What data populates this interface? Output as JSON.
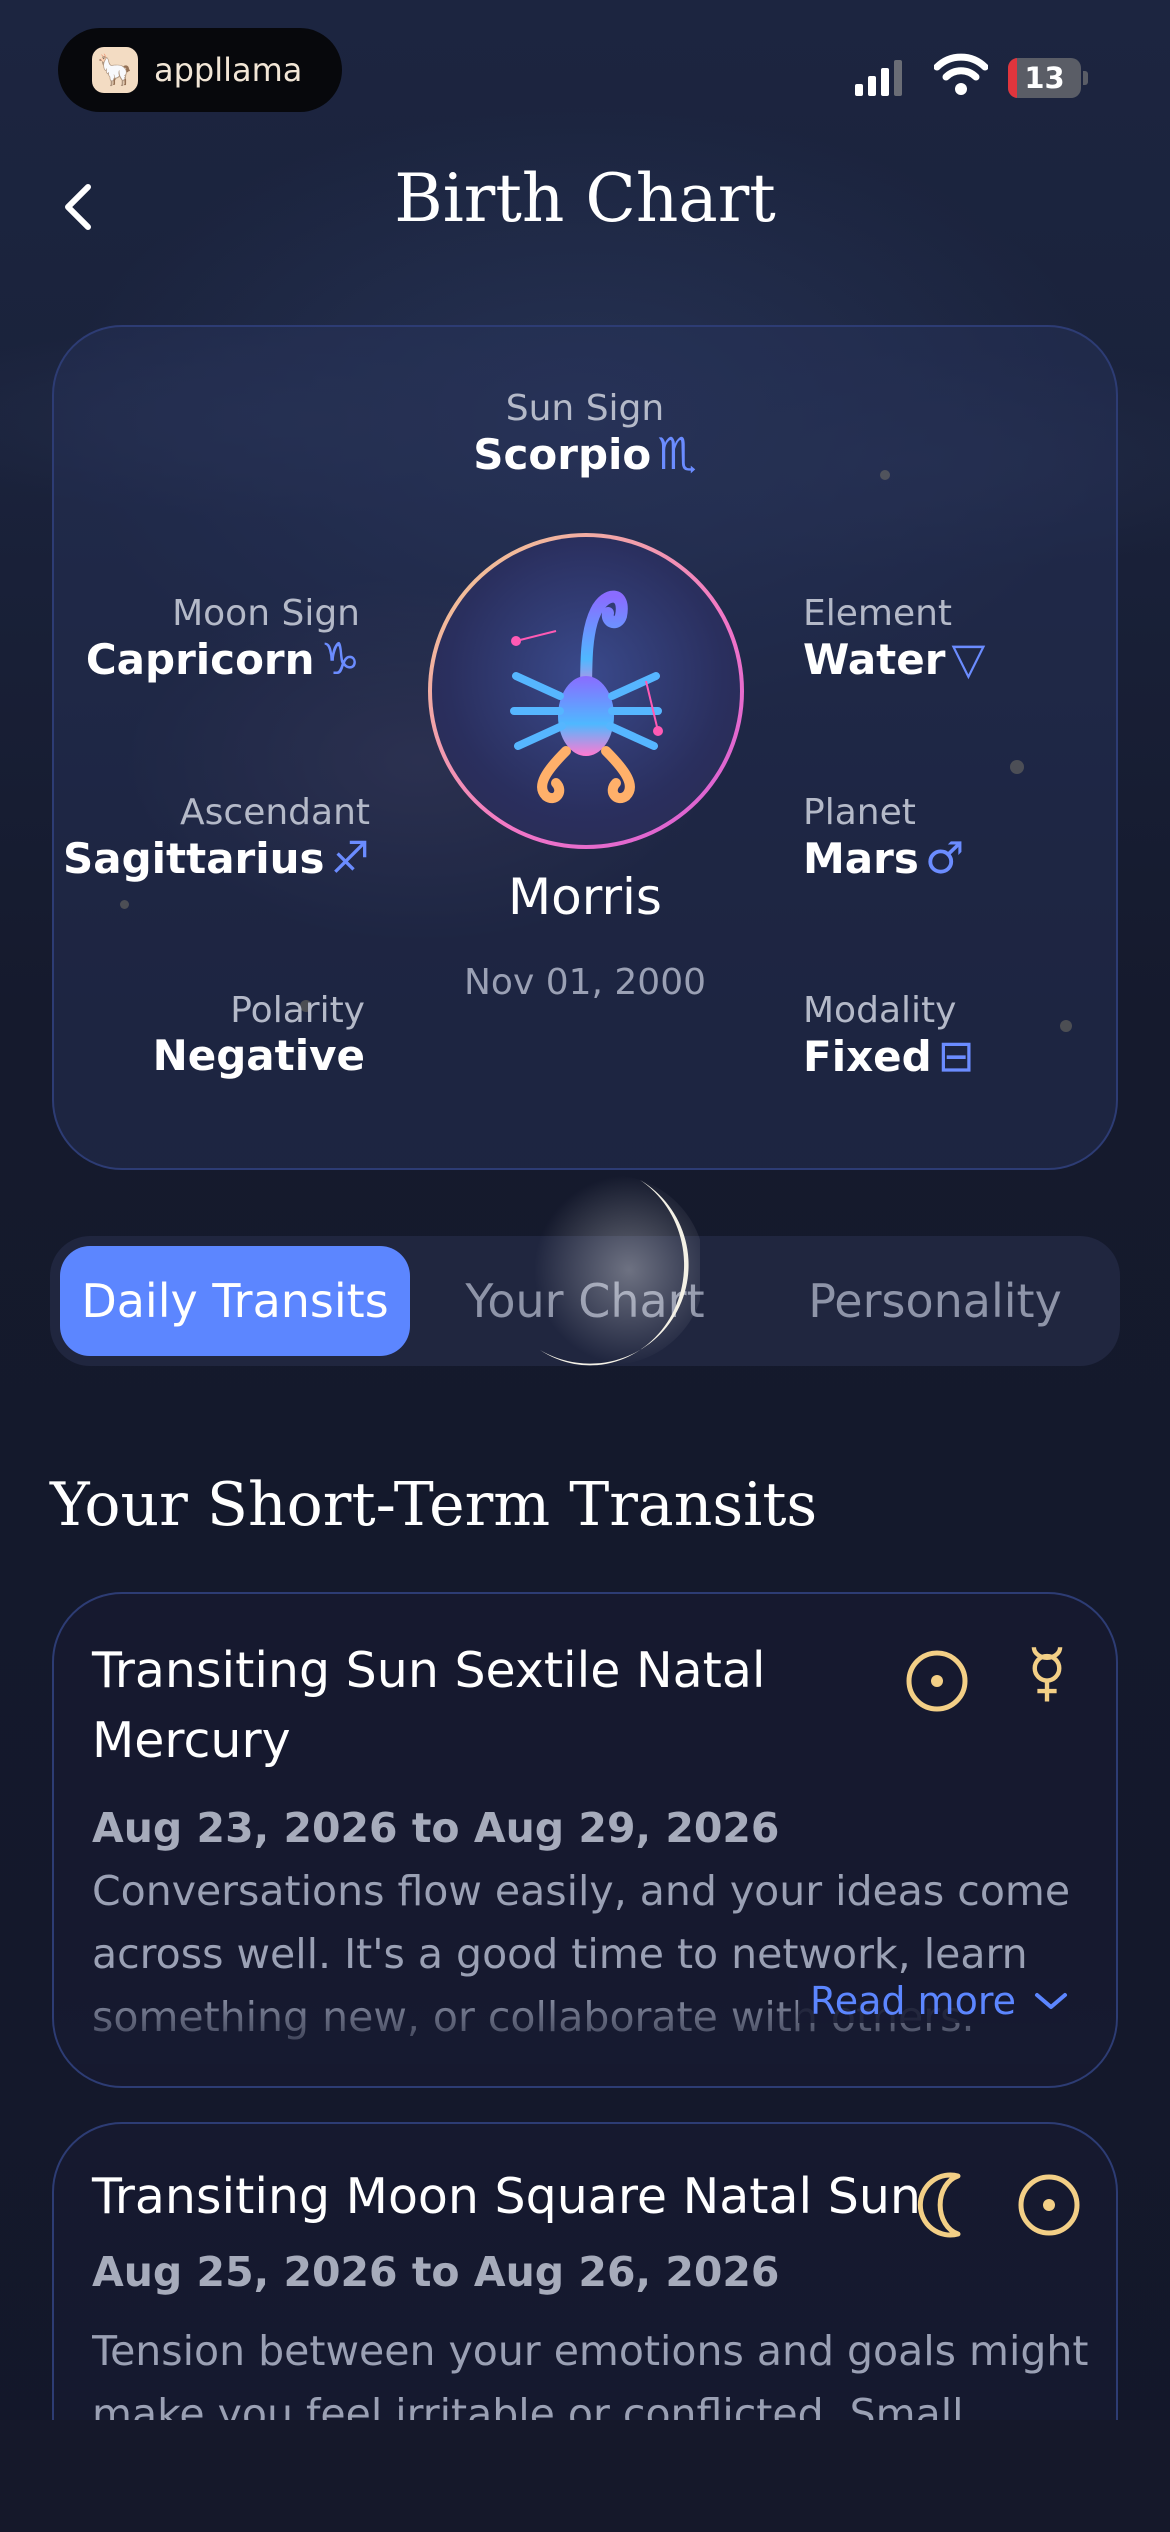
{
  "status_bar": {
    "app_name": "appllama",
    "battery_level": "13"
  },
  "header": {
    "title": "Birth Chart"
  },
  "profile": {
    "name": "Morris",
    "birth_date": "Nov 01, 2000",
    "sun_sign": {
      "label": "Sun Sign",
      "value": "Scorpio",
      "symbol": "♏"
    },
    "moon_sign": {
      "label": "Moon Sign",
      "value": "Capricorn",
      "symbol": "♑"
    },
    "ascendant": {
      "label": "Ascendant",
      "value": "Sagittarius",
      "symbol": "♐"
    },
    "polarity": {
      "label": "Polarity",
      "value": "Negative"
    },
    "element": {
      "label": "Element",
      "value": "Water",
      "symbol": "▽"
    },
    "planet": {
      "label": "Planet",
      "value": "Mars",
      "symbol": "♂"
    },
    "modality": {
      "label": "Modality",
      "value": "Fixed",
      "symbol": "⊟"
    }
  },
  "tabs": [
    {
      "label": "Daily Transits",
      "active": true
    },
    {
      "label": "Your Chart",
      "active": false
    },
    {
      "label": "Personality",
      "active": false
    }
  ],
  "section": {
    "title": "Your Short-Term Transits"
  },
  "transits": [
    {
      "title": "Transiting Sun Sextile Natal Mercury",
      "dates": "Aug 23, 2026 to Aug 29, 2026",
      "description": "Conversations flow easily, and your ideas come across well. It's a good time to network, learn something new, or collaborate with others. Small ...",
      "icons": [
        "sun-icon",
        "mercury-icon"
      ],
      "read_more": "Read more"
    },
    {
      "title": "Transiting Moon Square Natal Sun",
      "dates": "Aug 25, 2026 to Aug 26, 2026",
      "description": "Tension between your emotions and goals might make you feel irritable or conflicted. Small",
      "icons": [
        "moon-icon",
        "sun-icon"
      ]
    }
  ],
  "colors": {
    "accent": "#5c86ff",
    "gold": "#f3cf86",
    "card_border": "#2d3c74",
    "background": "#161a2e"
  }
}
